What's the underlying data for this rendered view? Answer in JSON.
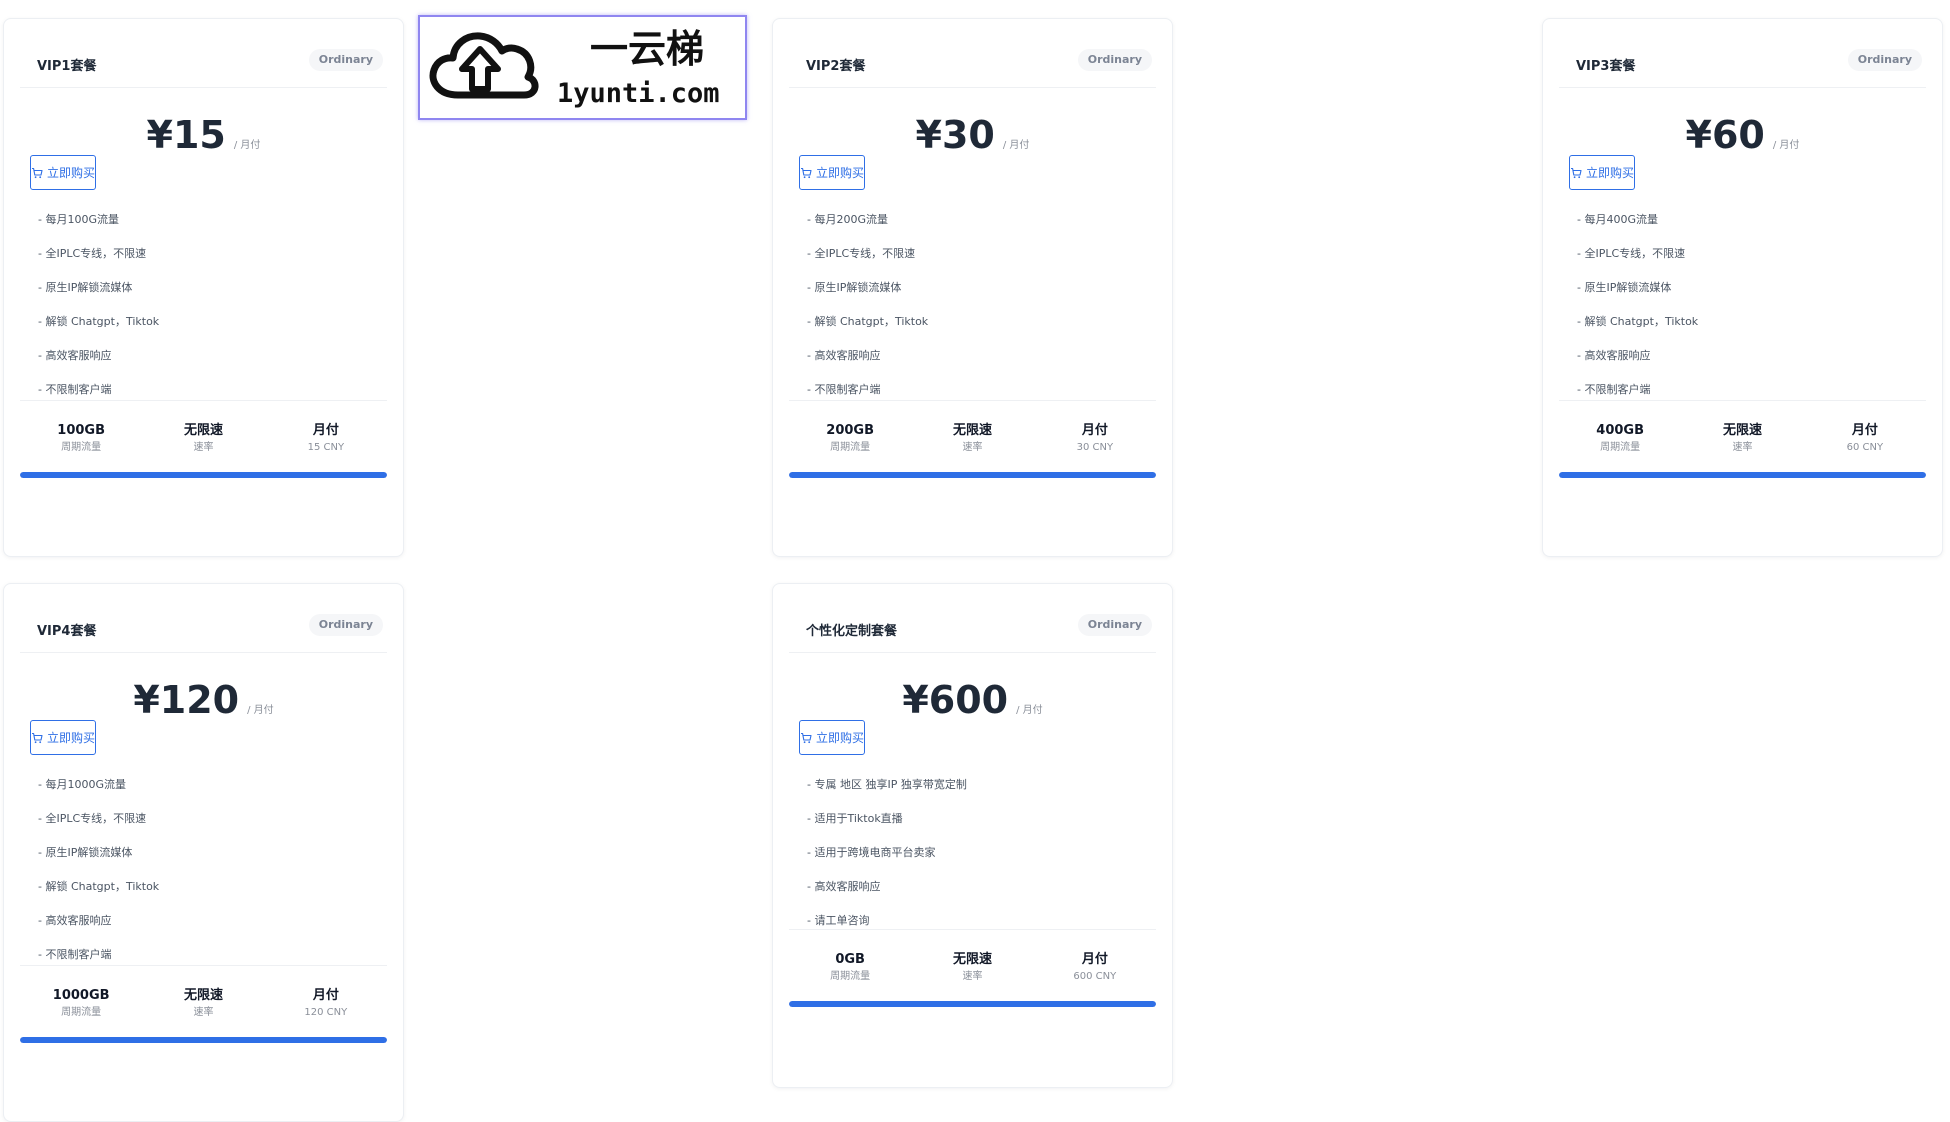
{
  "badge_label": "Ordinary",
  "buy_label": "立即购买",
  "price_unit": "/ 月付",
  "logo": {
    "top_text": "一云梯",
    "bottom_text": "1yunti.com"
  },
  "colors": {
    "accent": "#2f6fe6",
    "progress_track": "#e5e7eb",
    "badge_bg": "#f5f6f8"
  },
  "plans": [
    {
      "title": "VIP1套餐",
      "price": "¥15",
      "features": [
        "- 每月100G流量",
        "- 全IPLC专线，不限速",
        "- 原生IP解锁流媒体",
        "- 解锁 Chatgpt，Tiktok",
        "- 高效客服响应",
        "- 不限制客户端"
      ],
      "stats": [
        {
          "value": "100GB",
          "label": "周期流量"
        },
        {
          "value": "无限速",
          "label": "速率"
        },
        {
          "value": "月付",
          "label": "15 CNY"
        }
      ],
      "progress": 1.0
    },
    {
      "title": "VIP2套餐",
      "price": "¥30",
      "features": [
        "- 每月200G流量",
        "- 全IPLC专线，不限速",
        "- 原生IP解锁流媒体",
        "- 解锁 Chatgpt，Tiktok",
        "- 高效客服响应",
        "- 不限制客户端"
      ],
      "stats": [
        {
          "value": "200GB",
          "label": "周期流量"
        },
        {
          "value": "无限速",
          "label": "速率"
        },
        {
          "value": "月付",
          "label": "30 CNY"
        }
      ],
      "progress": 1.0
    },
    {
      "title": "VIP3套餐",
      "price": "¥60",
      "features": [
        "- 每月400G流量",
        "- 全IPLC专线，不限速",
        "- 原生IP解锁流媒体",
        "- 解锁 Chatgpt，Tiktok",
        "- 高效客服响应",
        "- 不限制客户端"
      ],
      "stats": [
        {
          "value": "400GB",
          "label": "周期流量"
        },
        {
          "value": "无限速",
          "label": "速率"
        },
        {
          "value": "月付",
          "label": "60 CNY"
        }
      ],
      "progress": 1.0
    },
    {
      "title": "VIP4套餐",
      "price": "¥120",
      "features": [
        "- 每月1000G流量",
        "- 全IPLC专线，不限速",
        "- 原生IP解锁流媒体",
        "- 解锁 Chatgpt，Tiktok",
        "- 高效客服响应",
        "- 不限制客户端"
      ],
      "stats": [
        {
          "value": "1000GB",
          "label": "周期流量"
        },
        {
          "value": "无限速",
          "label": "速率"
        },
        {
          "value": "月付",
          "label": "120 CNY"
        }
      ],
      "progress": 1.0
    },
    {
      "title": "个性化定制套餐",
      "price": "¥600",
      "features": [
        "- 专属 地区 独享IP 独享带宽定制",
        "- 适用于Tiktok直播",
        "- 适用于跨境电商平台卖家",
        "- 高效客服响应",
        "- 请工单咨询"
      ],
      "stats": [
        {
          "value": "0GB",
          "label": "周期流量"
        },
        {
          "value": "无限速",
          "label": "速率"
        },
        {
          "value": "月付",
          "label": "600 CNY"
        }
      ],
      "progress": 1.0
    }
  ]
}
